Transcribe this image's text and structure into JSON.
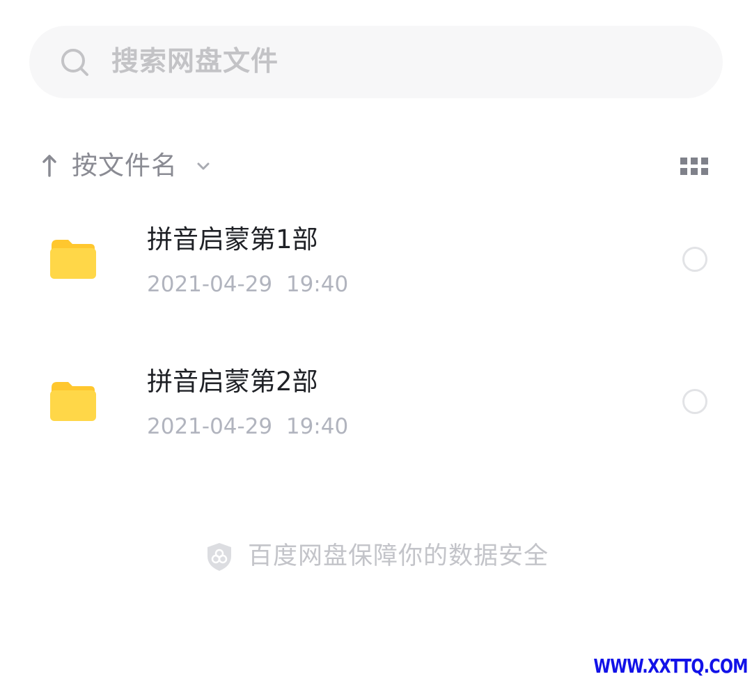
{
  "search": {
    "placeholder": "搜索网盘文件",
    "icon": "search-icon"
  },
  "sort": {
    "direction_icon": "arrow-up-icon",
    "label": "按文件名",
    "dropdown_icon": "chevron-down-icon",
    "view_toggle_icon": "grid-view-icon"
  },
  "files": [
    {
      "name": "拼音启蒙第1部",
      "date": "2021-04-29  19:40",
      "type": "folder"
    },
    {
      "name": "拼音启蒙第2部",
      "date": "2021-04-29  19:40",
      "type": "folder"
    }
  ],
  "footer": {
    "security_text": "百度网盘保障你的数据安全",
    "icon": "shield-icon"
  },
  "watermark": "WWW.XXTTQ.COM",
  "colors": {
    "folder": "#ffd748",
    "folder_tab": "#ffc72e",
    "search_bg": "#f7f7f8",
    "secondary_text": "#b1b4be",
    "primary_text": "#1f2126",
    "watermark": "#1212e8"
  }
}
